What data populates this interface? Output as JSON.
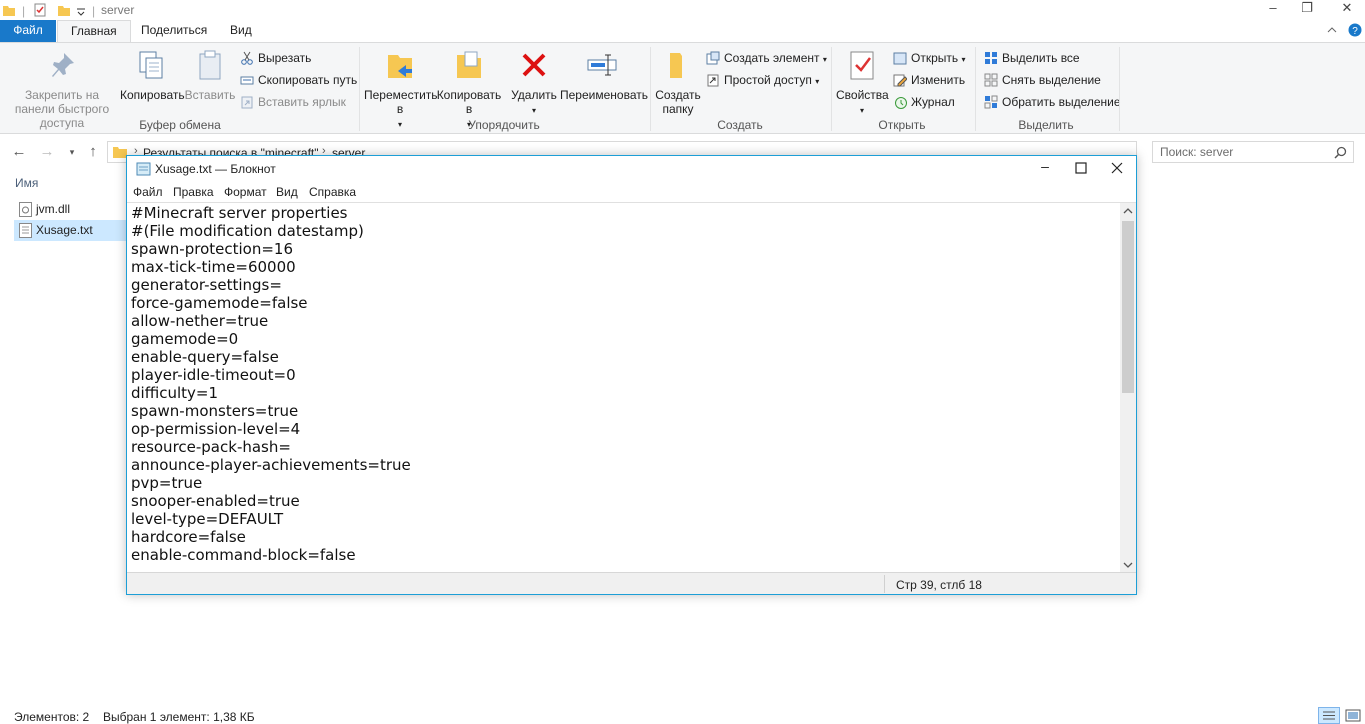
{
  "explorer": {
    "title": "server",
    "tabs": [
      "Файл",
      "Главная",
      "Поделиться",
      "Вид"
    ],
    "ribbon": {
      "clipboard": {
        "pin": "Закрепить на панели быстрого доступа",
        "copy": "Копировать",
        "paste": "Вставить",
        "cut": "Вырезать",
        "copy_path": "Скопировать путь",
        "paste_shortcut": "Вставить ярлык",
        "label": "Буфер обмена"
      },
      "organize": {
        "move": "Переместить в",
        "copy_to": "Копировать в",
        "delete": "Удалить",
        "rename": "Переименовать",
        "label": "Упорядочить"
      },
      "create": {
        "new_folder": "Создать папку",
        "new_item": "Создать элемент",
        "easy_access": "Простой доступ",
        "label": "Создать"
      },
      "open": {
        "properties": "Свойства",
        "open": "Открыть",
        "edit": "Изменить",
        "history": "Журнал",
        "label": "Открыть"
      },
      "select": {
        "select_all": "Выделить все",
        "select_none": "Снять выделение",
        "invert": "Обратить выделение",
        "label": "Выделить"
      }
    },
    "address": {
      "crumb1": "Результаты поиска в \"minecraft\"",
      "crumb2": "server"
    },
    "search_placeholder": "Поиск: server",
    "column_name": "Имя",
    "files": [
      {
        "name": "jvm.dll",
        "selected": false
      },
      {
        "name": "Xusage.txt",
        "selected": true
      }
    ],
    "status": {
      "count": "Элементов: 2",
      "selection": "Выбран 1 элемент: 1,38 КБ"
    }
  },
  "notepad": {
    "title": "Xusage.txt — Блокнот",
    "menu": [
      "Файл",
      "Правка",
      "Формат",
      "Вид",
      "Справка"
    ],
    "lines": [
      "#Minecraft server properties",
      "#(File modification datestamp)",
      "spawn-protection=16",
      "max-tick-time=60000",
      "generator-settings=",
      "force-gamemode=false",
      "allow-nether=true",
      "gamemode=0",
      "enable-query=false",
      "player-idle-timeout=0",
      "difficulty=1",
      "spawn-monsters=true",
      "op-permission-level=4",
      "resource-pack-hash=",
      "announce-player-achievements=true",
      "pvp=true",
      "snooper-enabled=true",
      "level-type=DEFAULT",
      "hardcore=false",
      "enable-command-block=false"
    ],
    "status_position": "Стр 39, стлб 18"
  },
  "colors": {
    "accent": "#1979ca",
    "selection": "#cce8ff",
    "notepad_border": "#1c9ed6"
  }
}
